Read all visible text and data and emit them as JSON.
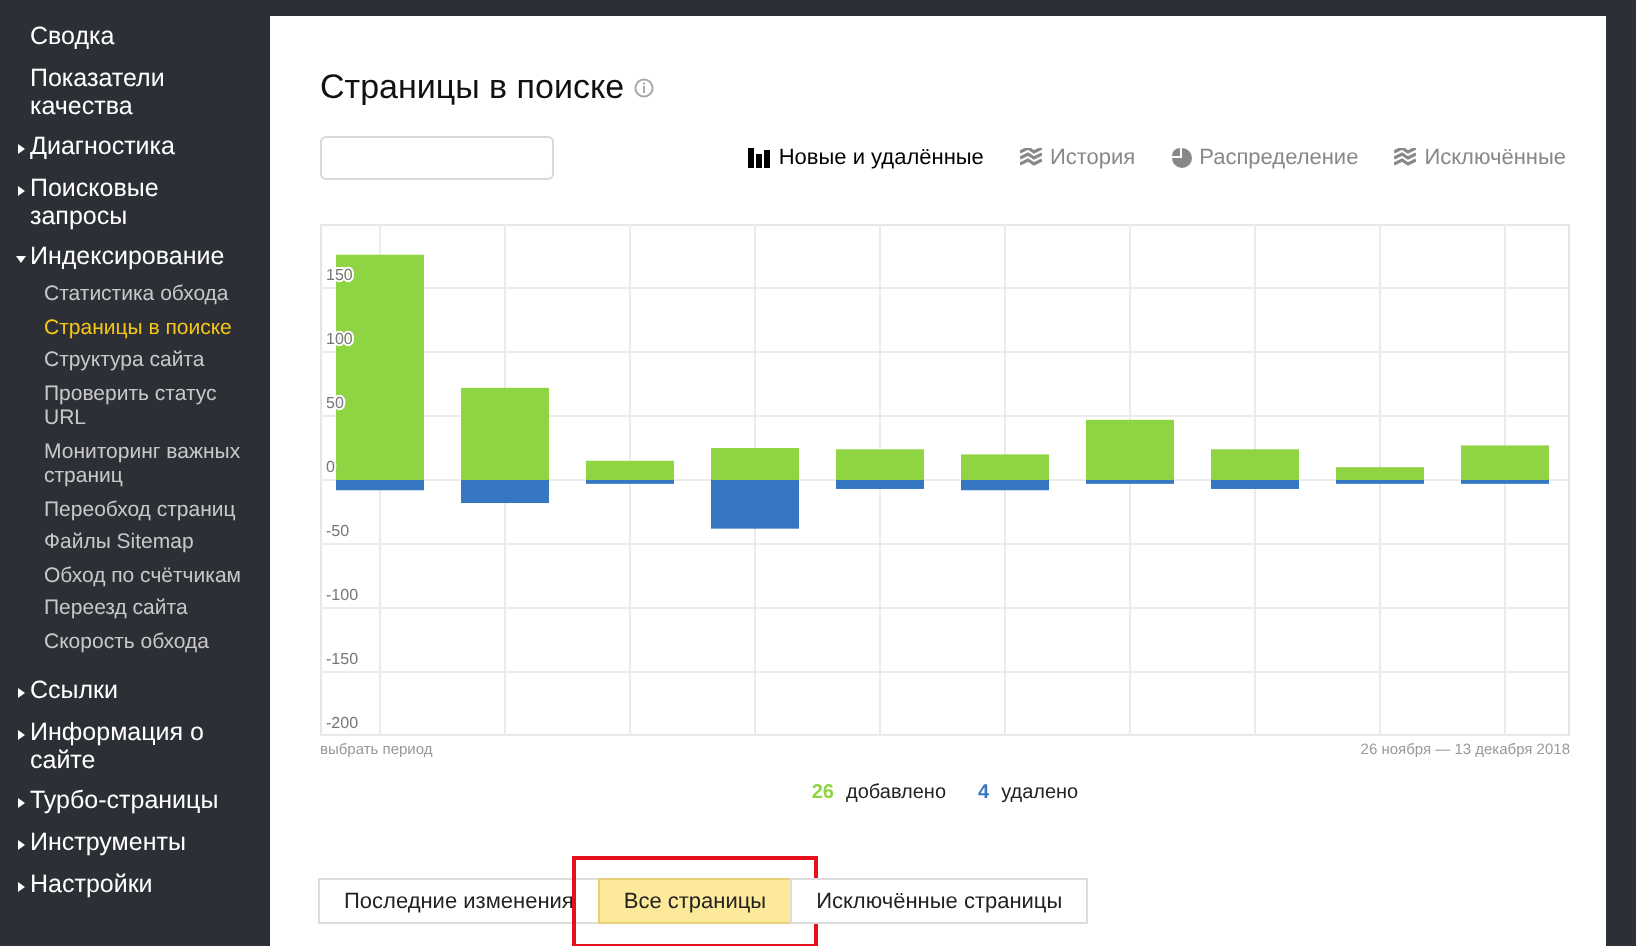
{
  "sidebar": {
    "items": [
      {
        "label": "Сводка",
        "kind": "link"
      },
      {
        "label": "Показатели качества",
        "kind": "link"
      },
      {
        "label": "Диагностика",
        "kind": "group",
        "expanded": false
      },
      {
        "label": "Поисковые запросы",
        "kind": "group",
        "expanded": false
      },
      {
        "label": "Индексирование",
        "kind": "group",
        "expanded": true,
        "children": [
          {
            "label": "Статистика обхода",
            "selected": false
          },
          {
            "label": "Страницы в поиске",
            "selected": true
          },
          {
            "label": "Структура сайта",
            "selected": false
          },
          {
            "label": "Проверить статус URL",
            "selected": false
          },
          {
            "label": "Мониторинг важных страниц",
            "selected": false
          },
          {
            "label": "Переобход страниц",
            "selected": false
          },
          {
            "label": "Файлы Sitemap",
            "selected": false
          },
          {
            "label": "Обход по счётчикам",
            "selected": false
          },
          {
            "label": "Переезд сайта",
            "selected": false
          },
          {
            "label": "Скорость обхода",
            "selected": false
          }
        ]
      },
      {
        "label": "Ссылки",
        "kind": "group",
        "expanded": false
      },
      {
        "label": "Информация о сайте",
        "kind": "group",
        "expanded": false
      },
      {
        "label": "Турбо-страницы",
        "kind": "group",
        "expanded": false
      },
      {
        "label": "Инструменты",
        "kind": "group",
        "expanded": false
      },
      {
        "label": "Настройки",
        "kind": "group",
        "expanded": false
      }
    ]
  },
  "page": {
    "title": "Страницы в поиске"
  },
  "views": [
    {
      "label": "Новые и удалённые",
      "kind": "bars",
      "selected": true
    },
    {
      "label": "История",
      "kind": "layers",
      "selected": false
    },
    {
      "label": "Распределение",
      "kind": "pie",
      "selected": false
    },
    {
      "label": "Исключённые",
      "kind": "layers",
      "selected": false
    }
  ],
  "chart": {
    "period_link": "выбрать период",
    "date_range": "26 ноября — 13 декабря 2018",
    "chart_data": {
      "type": "bar",
      "stacked": true,
      "grid": true,
      "ylim": [
        -200,
        200
      ],
      "yticks": [
        -200,
        -150,
        -100,
        -50,
        0,
        50,
        100,
        150
      ],
      "series": [
        {
          "name": "добавлено",
          "color": "#8fd443",
          "values": [
            176,
            72,
            15,
            25,
            24,
            20,
            47,
            24,
            10,
            27
          ]
        },
        {
          "name": "удалено",
          "color": "#3677c2",
          "values": [
            -8,
            -18,
            -3,
            -38,
            -7,
            -8,
            -3,
            -7,
            -3,
            -3
          ]
        }
      ]
    }
  },
  "legend": [
    {
      "count": "26"
    },
    {
      "count": "4"
    }
  ],
  "bottom_tabs": [
    {
      "label": "Последние изменения",
      "selected": false
    },
    {
      "label": "Все страницы",
      "selected": true,
      "highlighted": true
    },
    {
      "label": "Исключённые страницы",
      "selected": false
    }
  ]
}
